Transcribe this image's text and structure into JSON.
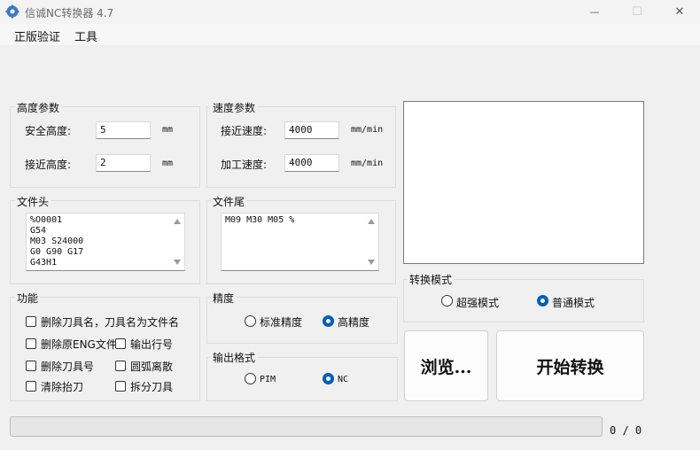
{
  "window": {
    "title": "信诚NC转换器 4.7",
    "minimize_glyph": "—",
    "maximize_glyph": "☐",
    "close_glyph": "✕"
  },
  "menu": {
    "items": [
      "正版验证",
      "工具"
    ]
  },
  "height_params": {
    "title": "高度参数",
    "safe_height_label": "安全高度:",
    "safe_height_value": "5",
    "safe_height_unit": "mm",
    "approach_height_label": "接近高度:",
    "approach_height_value": "2",
    "approach_height_unit": "mm"
  },
  "speed_params": {
    "title": "速度参数",
    "approach_speed_label": "接近速度:",
    "approach_speed_value": "4000",
    "approach_speed_unit": "mm/min",
    "feed_speed_label": "加工速度:",
    "feed_speed_value": "4000",
    "feed_speed_unit": "mm/min"
  },
  "file_header": {
    "title": "文件头",
    "lines": [
      "%O0001",
      "G54",
      "M03 S24000",
      "G0 G90 G17",
      "G43H1"
    ]
  },
  "file_footer": {
    "title": "文件尾",
    "lines": [
      "M09 M30 M05 %"
    ]
  },
  "functions": {
    "title": "功能",
    "options": [
      "删除刀具名，刀具名为文件名",
      "删除原ENG文件",
      "输出行号",
      "删除刀具号",
      "圆弧离散",
      "清除抬刀",
      "拆分刀具"
    ]
  },
  "precision": {
    "title": "精度",
    "options": [
      "标准精度",
      "高精度"
    ],
    "selected": "高精度"
  },
  "output_format": {
    "title": "输出格式",
    "options": [
      "PIM",
      "NC"
    ],
    "selected": "NC"
  },
  "convert_mode": {
    "title": "转换模式",
    "options": [
      "超强模式",
      "普通模式"
    ],
    "selected": "普通模式"
  },
  "buttons": {
    "browse": "浏览...",
    "start": "开始转换"
  },
  "progress": {
    "counter": "0 / 0",
    "fraction": 0
  },
  "colors": {
    "accent": "#005fb8"
  }
}
